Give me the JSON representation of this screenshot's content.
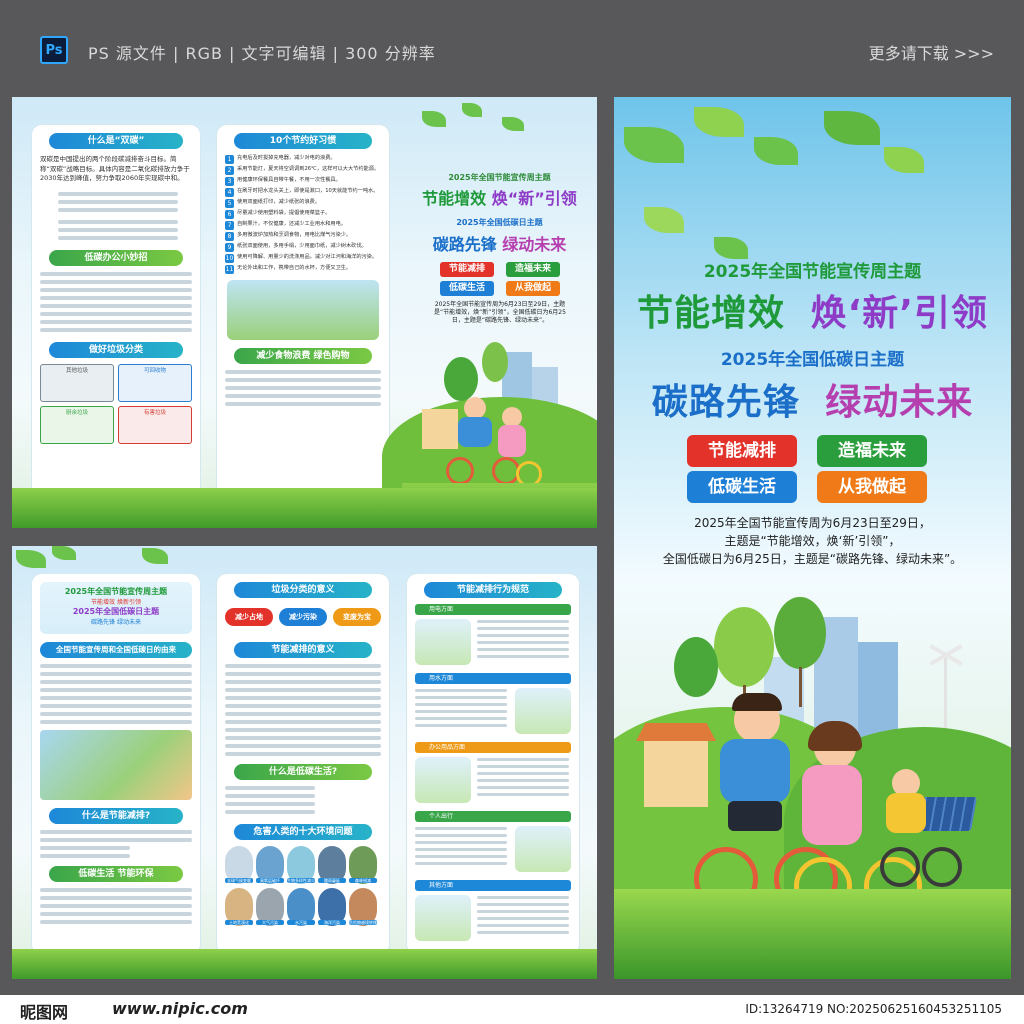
{
  "header": {
    "ps_badge": "Ps",
    "info": "PS 源文件 | RGB | 文字可编辑 | 300 分辨率",
    "more": "更多请下载 >>>"
  },
  "panel_a_left": {
    "card1_title": "什么是“双碳”",
    "card1_intro": "双碳是中国提出的两个阶段碳减排奋斗目标。简称“双碳”战略目标。具体内容是二氧化碳排放力争于2030年达到峰值，努力争取2060年实现碳中和。",
    "card2_title": "低碳办公小妙招",
    "card3_title": "做好垃圾分类",
    "bins": [
      "其他垃圾",
      "可回收物",
      "厨余垃圾",
      "有害垃圾"
    ]
  },
  "panel_a_mid": {
    "title": "10个节约好习惯",
    "items": [
      "充电后及时拔掉充电器，减少对电的浪费。",
      "采用节能灯，夏天将空调调到26℃，这样可以大大节约能源。",
      "用健康环保餐具自带午餐，不用一次性餐具。",
      "在刷牙时把水龙头关上，即使是漱口，10天就能节约一吨水。",
      "使用双面纸打印，减少纸张的浪费。",
      "尽量减少使用塑料袋，提倡使用菜篮子。",
      "自制果汁，不仅健康，还减少工业用水和用电。",
      "多用微波炉加热和烹调食物，用电比煤气污染少。",
      "纸张双面使用，多用手绢，少用面巾纸，减少树木砍伐。",
      "使用可降解、用量少的洗涤用品，减少对江河和海洋的污染。",
      "无论外出和工作，携带自己的水杯，方便又卫生。"
    ],
    "sub_title": "减少食物浪费 绿色购物"
  },
  "panel_a_right": {
    "small_title1": "2025年全国节能宣传周主题",
    "slogan1a": "节能增效",
    "slogan1b": "焕“新”引领",
    "small_title2": "2025年全国低碳日主题",
    "slogan2a": "碳路先锋",
    "slogan2b": "绿动未来",
    "pills": [
      "节能减排",
      "造福未来",
      "低碳生活",
      "从我做起"
    ],
    "intro": "2025年全国节能宣传周为6月23日至29日，主题是“节能增效，焕“新”引领”，全国低碳日为6月25日，主题是“碳路先锋、绿动未来”。"
  },
  "panel_b_left": {
    "banner_line1": "2025年全国节能宣传周主题",
    "banner_line2": "节能增效 焕新引领",
    "banner_line3": "2025年全国低碳日主题",
    "banner_line4": "碳路先锋 绿动未来",
    "card1_title": "全国节能宣传周和全国低碳日的由来",
    "card2_title": "什么是节能减排?",
    "card3_title": "低碳生活 节能环保"
  },
  "panel_b_mid": {
    "title1": "垃圾分类的意义",
    "tags": [
      "减少占地",
      "减少污染",
      "变废为宝"
    ],
    "title2": "节能减排的意义",
    "title3": "什么是低碳生活?",
    "title4": "危害人类的十大环境问题",
    "env_labels": [
      "全球气候变暖",
      "臭氧层破坏",
      "生物多样性减少",
      "酸雨蔓延",
      "森林锐减",
      "土地荒漠化",
      "大气污染",
      "水污染",
      "海洋污染",
      "危险物越境转移"
    ]
  },
  "panel_b_right": {
    "title": "节能减排行为规范",
    "sections": [
      "用电方面",
      "用水方面",
      "办公用品方面",
      "个人出行",
      "其他方面"
    ]
  },
  "panel_c": {
    "title1": "2025年全国节能宣传周主题",
    "slogan1a": "节能增效",
    "slogan1b": "焕‘新’引领",
    "title2": "2025年全国低碳日主题",
    "slogan2a": "碳路先锋",
    "slogan2b": "绿动未来",
    "pills": [
      "节能减排",
      "造福未来",
      "低碳生活",
      "从我做起"
    ],
    "intro_line1": "2025年全国节能宣传周为6月23日至29日，",
    "intro_line2": "主题是“节能增效，焕‘新’引领”，",
    "intro_line3": "全国低碳日为6月25日，主题是“碳路先锋、绿动未来”。"
  },
  "footer": {
    "brand": "昵图网",
    "url": "www.nipic.com",
    "id": "ID:13264719 NO:20250625160453251105"
  },
  "colors": {
    "pill_red": "#e2322a",
    "pill_green": "#2a9d3c",
    "pill_blue": "#1d7fd6",
    "pill_orange": "#ef7a17",
    "title_green": "#1f9a3a",
    "title_blue": "#1b6fc9",
    "title_purple": "#8e3cc7"
  }
}
